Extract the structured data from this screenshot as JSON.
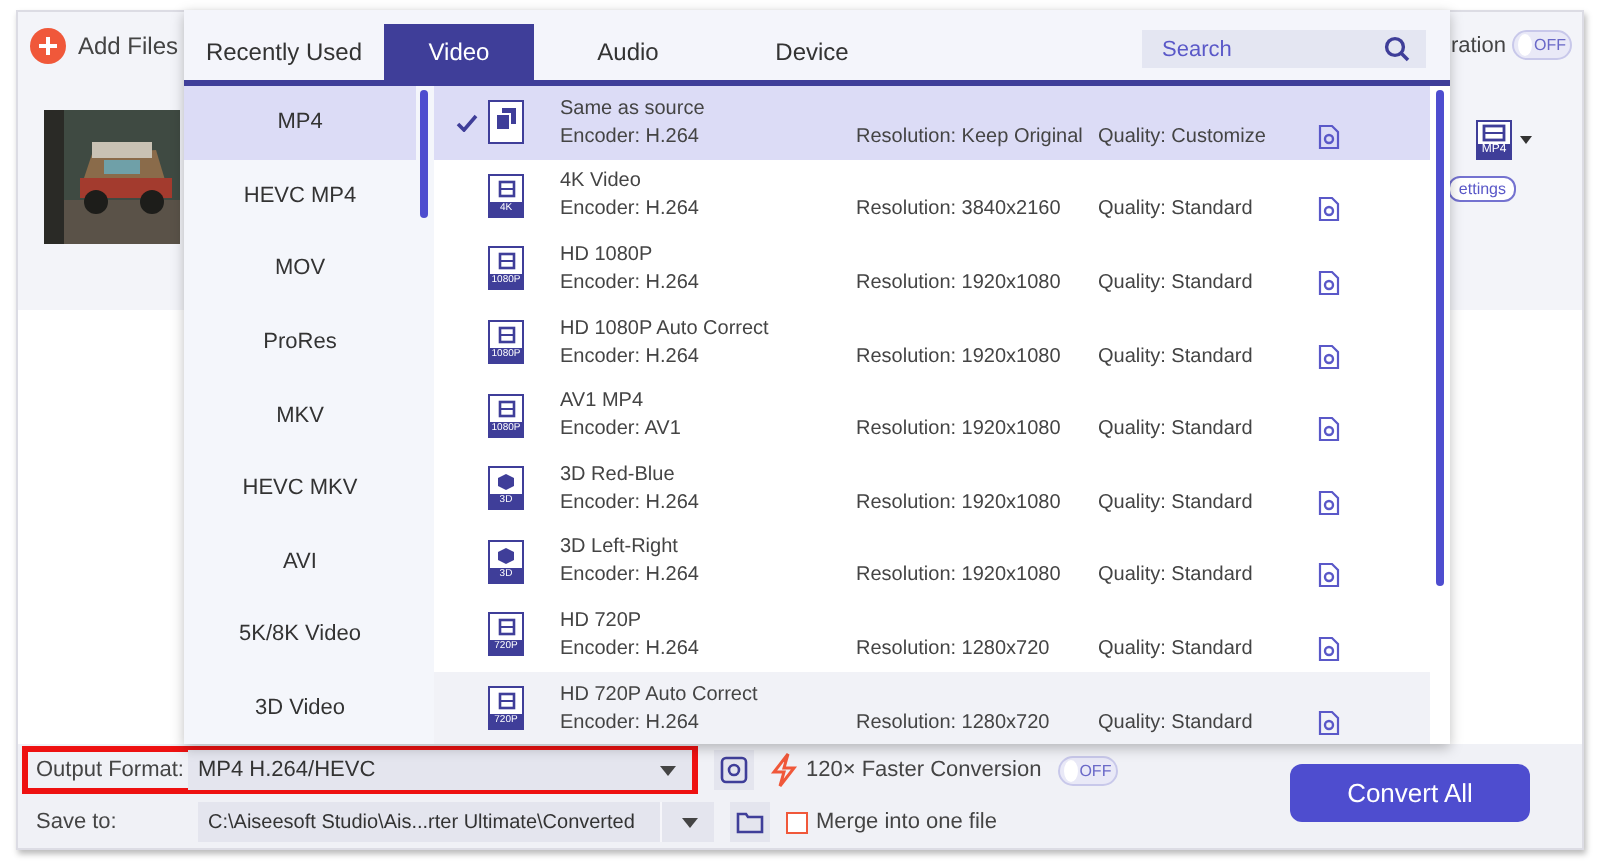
{
  "toolbar": {
    "add_files": "Add Files",
    "acceleration_label": "ration",
    "acceleration_toggle": {
      "on": false,
      "label": "OFF"
    }
  },
  "file_item": {
    "format_badge": "MP4",
    "settings_label": "ettings"
  },
  "format_popup": {
    "tabs": [
      {
        "label": "Recently Used",
        "selected": false
      },
      {
        "label": "Video",
        "selected": true
      },
      {
        "label": "Audio",
        "selected": false
      },
      {
        "label": "Device",
        "selected": false
      }
    ],
    "search": {
      "placeholder": "Search"
    },
    "categories": [
      {
        "label": "MP4",
        "selected": true
      },
      {
        "label": "HEVC MP4",
        "selected": false
      },
      {
        "label": "MOV",
        "selected": false
      },
      {
        "label": "ProRes",
        "selected": false
      },
      {
        "label": "MKV",
        "selected": false
      },
      {
        "label": "HEVC MKV",
        "selected": false
      },
      {
        "label": "AVI",
        "selected": false
      },
      {
        "label": "5K/8K Video",
        "selected": false
      },
      {
        "label": "3D Video",
        "selected": false
      }
    ],
    "presets": [
      {
        "kind": "source",
        "name": "Same as source",
        "encoder": "Encoder: H.264",
        "resolution": "Resolution: Keep Original",
        "quality": "Quality: Customize",
        "selected": true,
        "hovered": false
      },
      {
        "kind": "film",
        "name": "4K Video",
        "badge": "4K",
        "encoder": "Encoder: H.264",
        "resolution": "Resolution: 3840x2160",
        "quality": "Quality: Standard",
        "selected": false,
        "hovered": false
      },
      {
        "kind": "film",
        "name": "HD 1080P",
        "badge": "1080P",
        "encoder": "Encoder: H.264",
        "resolution": "Resolution: 1920x1080",
        "quality": "Quality: Standard",
        "selected": false,
        "hovered": false
      },
      {
        "kind": "film",
        "name": "HD 1080P Auto Correct",
        "badge": "1080P",
        "encoder": "Encoder: H.264",
        "resolution": "Resolution: 1920x1080",
        "quality": "Quality: Standard",
        "selected": false,
        "hovered": false
      },
      {
        "kind": "film",
        "name": "AV1 MP4",
        "badge": "1080P",
        "encoder": "Encoder: AV1",
        "resolution": "Resolution: 1920x1080",
        "quality": "Quality: Standard",
        "selected": false,
        "hovered": false
      },
      {
        "kind": "cube",
        "name": "3D Red-Blue",
        "badge": "3D",
        "encoder": "Encoder: H.264",
        "resolution": "Resolution: 1920x1080",
        "quality": "Quality: Standard",
        "selected": false,
        "hovered": false
      },
      {
        "kind": "cube",
        "name": "3D Left-Right",
        "badge": "3D",
        "encoder": "Encoder: H.264",
        "resolution": "Resolution: 1920x1080",
        "quality": "Quality: Standard",
        "selected": false,
        "hovered": false
      },
      {
        "kind": "film",
        "name": "HD 720P",
        "badge": "720P",
        "encoder": "Encoder: H.264",
        "resolution": "Resolution: 1280x720",
        "quality": "Quality: Standard",
        "selected": false,
        "hovered": false
      },
      {
        "kind": "film",
        "name": "HD 720P Auto Correct",
        "badge": "720P",
        "encoder": "Encoder: H.264",
        "resolution": "Resolution: 1280x720",
        "quality": "Quality: Standard",
        "selected": false,
        "hovered": true
      }
    ]
  },
  "bottom_bar": {
    "output_format": {
      "label": "Output Format:",
      "value": "MP4 H.264/HEVC",
      "highlighted": true
    },
    "save_to": {
      "label": "Save to:",
      "value": "C:\\Aiseesoft Studio\\Ais...rter Ultimate\\Converted"
    },
    "faster_conversion": {
      "label": "120× Faster Conversion",
      "toggle": {
        "on": false,
        "label": "OFF"
      }
    },
    "merge": {
      "label": "Merge into one file",
      "checked": false
    },
    "convert_all": "Convert All"
  }
}
